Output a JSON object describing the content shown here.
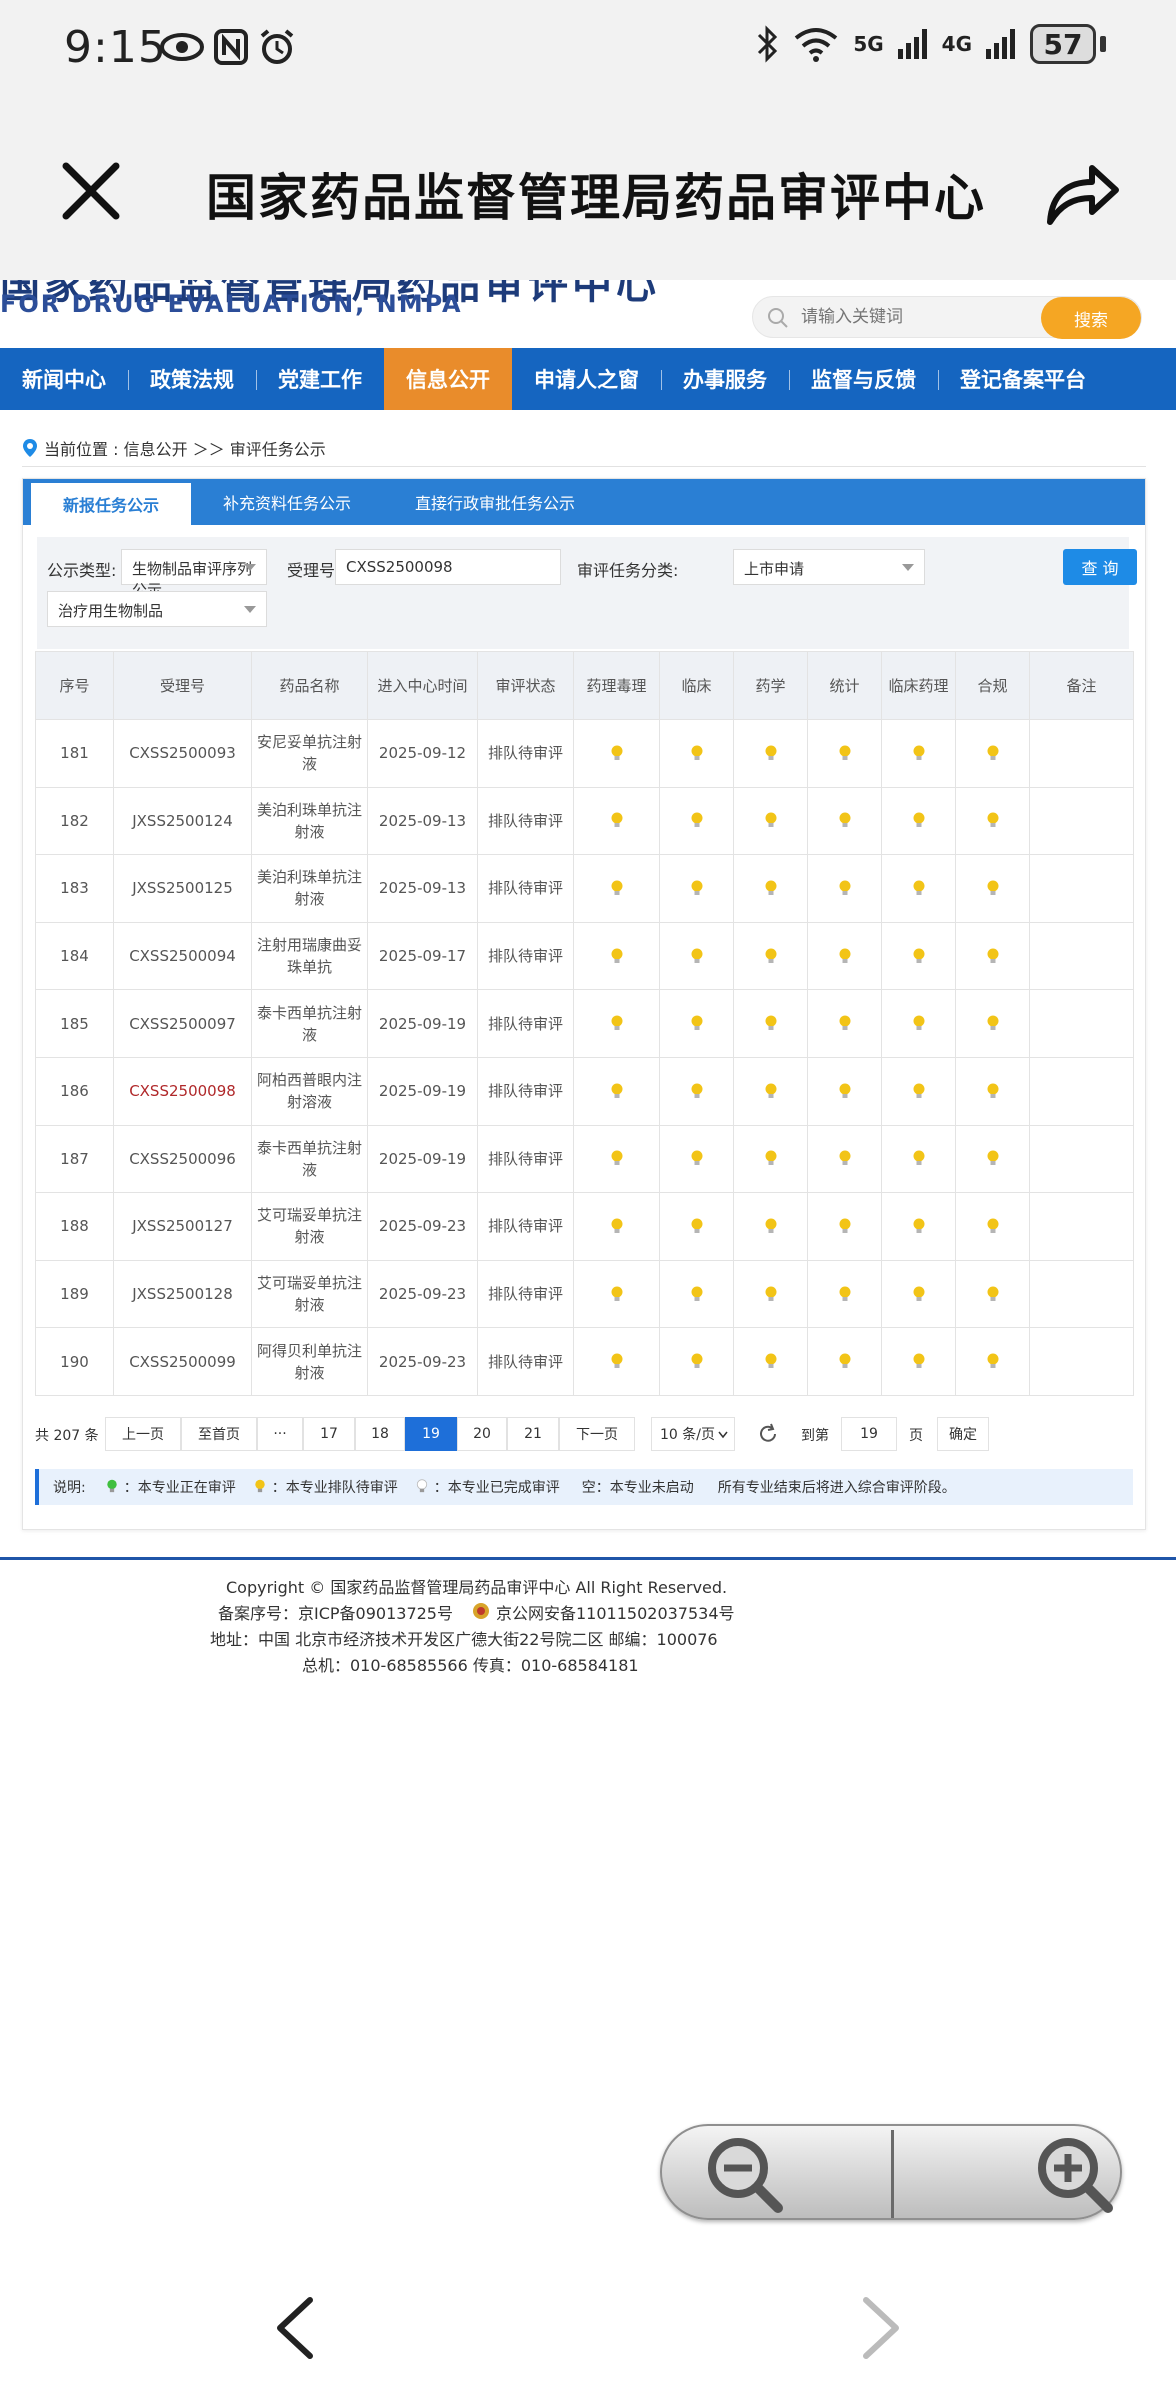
{
  "status_bar": {
    "time": "9:15",
    "battery": "57",
    "network_1": "5G",
    "network_2": "4G"
  },
  "app": {
    "title": "国家药品监督管理局药品审评中心",
    "close_icon": "close-icon",
    "share_icon": "share-icon"
  },
  "site": {
    "cut_title": "国家药品监督管理局药品审评中心",
    "english_name": "FOR DRUG EVALUATION, NMPA",
    "search_placeholder": "请输入关键词",
    "search_button": "搜索"
  },
  "nav": [
    "新闻中心",
    "政策法规",
    "党建工作",
    "信息公开",
    "申请人之窗",
    "办事服务",
    "监督与反馈",
    "登记备案平台"
  ],
  "breadcrumb": "当前位置 : 信息公开 ＞＞ 审评任务公示",
  "tabs": [
    "新报任务公示",
    "补充资料任务公示",
    "直接行政审批任务公示"
  ],
  "filters": {
    "type_label": "公示类型:",
    "type_value": "生物制品审评序列公示",
    "accept_label": "受理号:",
    "accept_value": "CXSS2500098",
    "category_label": "审评任务分类:",
    "category_value": "上市申请",
    "subtype_value": "治疗用生物制品",
    "query_button": "查 询"
  },
  "table": {
    "headers": [
      "序号",
      "受理号",
      "药品名称",
      "进入中心时间",
      "审评状态",
      "药理毒理",
      "临床",
      "药学",
      "统计",
      "临床药理",
      "合规",
      "备注"
    ],
    "rows": [
      [
        "181",
        "CXSS2500093",
        "安尼妥单抗注射液",
        "2025-09-12",
        "排队待审评"
      ],
      [
        "182",
        "JXSS2500124",
        "美泊利珠单抗注射液",
        "2025-09-13",
        "排队待审评"
      ],
      [
        "183",
        "JXSS2500125",
        "美泊利珠单抗注射液",
        "2025-09-13",
        "排队待审评"
      ],
      [
        "184",
        "CXSS2500094",
        "注射用瑞康曲妥珠单抗",
        "2025-09-17",
        "排队待审评"
      ],
      [
        "185",
        "CXSS2500097",
        "泰卡西单抗注射液",
        "2025-09-19",
        "排队待审评"
      ],
      [
        "186",
        "CXSS2500098",
        "阿柏西普眼内注射溶液",
        "2025-09-19",
        "排队待审评"
      ],
      [
        "187",
        "CXSS2500096",
        "泰卡西单抗注射液",
        "2025-09-19",
        "排队待审评"
      ],
      [
        "188",
        "JXSS2500127",
        "艾可瑞妥单抗注射液",
        "2025-09-23",
        "排队待审评"
      ],
      [
        "189",
        "JXSS2500128",
        "艾可瑞妥单抗注射液",
        "2025-09-23",
        "排队待审评"
      ],
      [
        "190",
        "CXSS2500099",
        "阿得贝利单抗注射液",
        "2025-09-23",
        "排队待审评"
      ]
    ],
    "highlight_row": 5,
    "highlight_color": "#b0282a",
    "bulb_color_pending": "#f2c417"
  },
  "pager": {
    "total": "共 207 条",
    "prev": "上一页",
    "first": "至首页",
    "ellipsis": "···",
    "pages": [
      "17",
      "18",
      "19",
      "20",
      "21"
    ],
    "current": "19",
    "next": "下一页",
    "page_size": "10 条/页",
    "goto_label": "到第",
    "goto_value": "19",
    "page_unit": "页",
    "confirm": "确定"
  },
  "legend": {
    "title": "说明:",
    "in_review": "：本专业正在审评",
    "pending": "：本专业排队待审评",
    "done": "：本专业已完成审评",
    "empty": "空：本专业未启动",
    "note": "所有专业结束后将进入综合审评阶段。",
    "colors": {
      "in_review": "#3fbf3f",
      "pending": "#f2c417",
      "done": "#d0d0d0"
    }
  },
  "footer": {
    "copyright": "Copyright © 国家药品监督管理局药品审评中心   All Right Reserved.",
    "icp": "备案序号：京ICP备09013725号",
    "police": "京公网安备11011502037534号",
    "address": "地址：中国 北京市经济技术开发区广德大街22号院二区      邮编：100076",
    "phone": "总机：010-68585566      传真：010-68584181"
  },
  "controls": {
    "zoom_out": "zoom-out-icon",
    "zoom_in": "zoom-in-icon",
    "back": "back-arrow-icon",
    "forward": "forward-arrow-icon"
  }
}
